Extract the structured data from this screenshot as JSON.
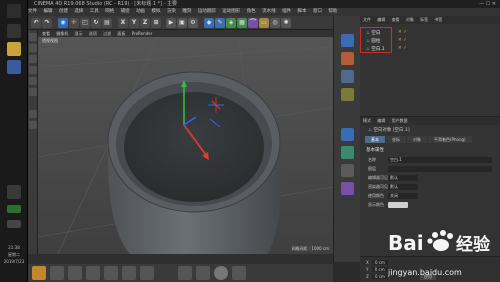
{
  "window": {
    "title": "CINEMA 4D R19.068 Studio (RC - R19) - [未标题 1 *] - 主要"
  },
  "menubar": {
    "items": [
      "文件",
      "编辑",
      "创建",
      "选择",
      "工具",
      "网格",
      "捕捉",
      "动画",
      "模拟",
      "渲染",
      "雕刻",
      "运动跟踪",
      "运动图形",
      "角色",
      "流水线",
      "插件",
      "脚本",
      "窗口",
      "帮助"
    ]
  },
  "toolbar": {
    "axis_labels": [
      "X",
      "Y",
      "Z"
    ]
  },
  "viewport": {
    "menu": [
      "查看",
      "摄像机",
      "显示",
      "选项",
      "过滤",
      "面板",
      "ProRender"
    ],
    "label": "透视视图",
    "grid_distance": "网格间距 : 1000 cm"
  },
  "object_manager": {
    "menu": [
      "文件",
      "编辑",
      "查看",
      "对象",
      "标签",
      "书签"
    ],
    "objects": [
      "空白",
      "圆柱",
      "空白.1"
    ]
  },
  "attribute_manager": {
    "menu": [
      "模式",
      "编辑",
      "用户数据"
    ],
    "object_title": "空白对象 [空白.1]",
    "tabs": [
      "基本",
      "坐标",
      "对象",
      "平滑着色(Phong)"
    ],
    "section": "基本属性",
    "fields": [
      {
        "label": "名称",
        "value": "空白.1"
      },
      {
        "label": "图层",
        "value": ""
      },
      {
        "label": "编辑器可见",
        "value": "默认"
      },
      {
        "label": "渲染器可见",
        "value": "默认"
      },
      {
        "label": "使用颜色",
        "value": "关闭"
      },
      {
        "label": "显示颜色",
        "value": ""
      }
    ]
  },
  "coord_panel": {
    "rows": [
      {
        "axis": "X",
        "value": "0 cm"
      },
      {
        "axis": "Y",
        "value": "0 cm"
      },
      {
        "axis": "Z",
        "value": "0 cm"
      }
    ],
    "apply_label": "应用"
  },
  "os_taskbar": {
    "time": "21:38",
    "day": "星期二",
    "date": "2019/7/23"
  },
  "watermark": {
    "brand": "Bai 经验",
    "url": "jingyan.baidu.com"
  },
  "colors": {
    "accent_red": "#d42a2a",
    "axis_x": "#e23b2b",
    "axis_y": "#2fbf3a",
    "axis_z": "#3a5cff"
  }
}
